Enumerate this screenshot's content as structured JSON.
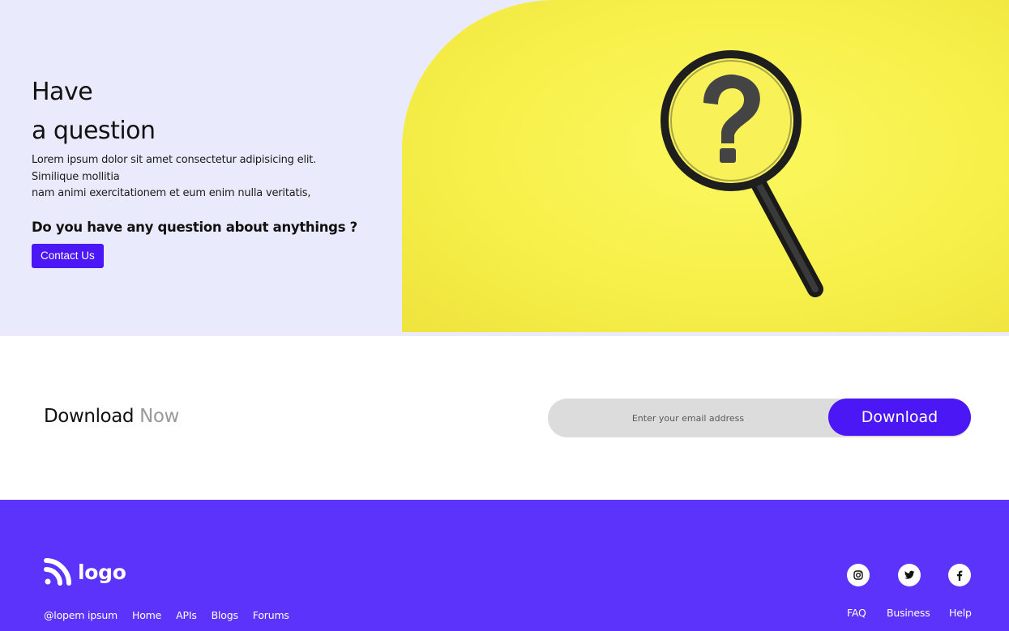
{
  "hero": {
    "title_line1": "Have",
    "title_line2": "a question",
    "desc_line1": "Lorem ipsum dolor sit amet consectetur adipisicing elit.",
    "desc_line2": "Similique mollitia",
    "desc_line3": "nam animi exercitationem et eum enim nulla veritatis,",
    "question": "Do you have any question about anythings ?",
    "contact_label": "Contact Us",
    "image_icon": "magnifying-glass-question-icon",
    "image_bg": "#f9f34f"
  },
  "download": {
    "title_main": "Download",
    "title_muted": "Now",
    "email_placeholder": "Enter your email address",
    "button_label": "Download"
  },
  "footer": {
    "logo_text": "logo",
    "logo_icon": "rss-feed-icon",
    "handle": "@lopem ipsum",
    "nav": [
      "Home",
      "APIs",
      "Blogs",
      "Forums"
    ],
    "social_icons": [
      "instagram-icon",
      "twitter-icon",
      "facebook-icon"
    ],
    "right_links": [
      "FAQ",
      "Business",
      "Help"
    ]
  },
  "colors": {
    "accent": "#4b17f5",
    "footer_bg": "#5b33fb",
    "hero_bg": "#e9ebfc",
    "muted": "#9a9a9a"
  }
}
